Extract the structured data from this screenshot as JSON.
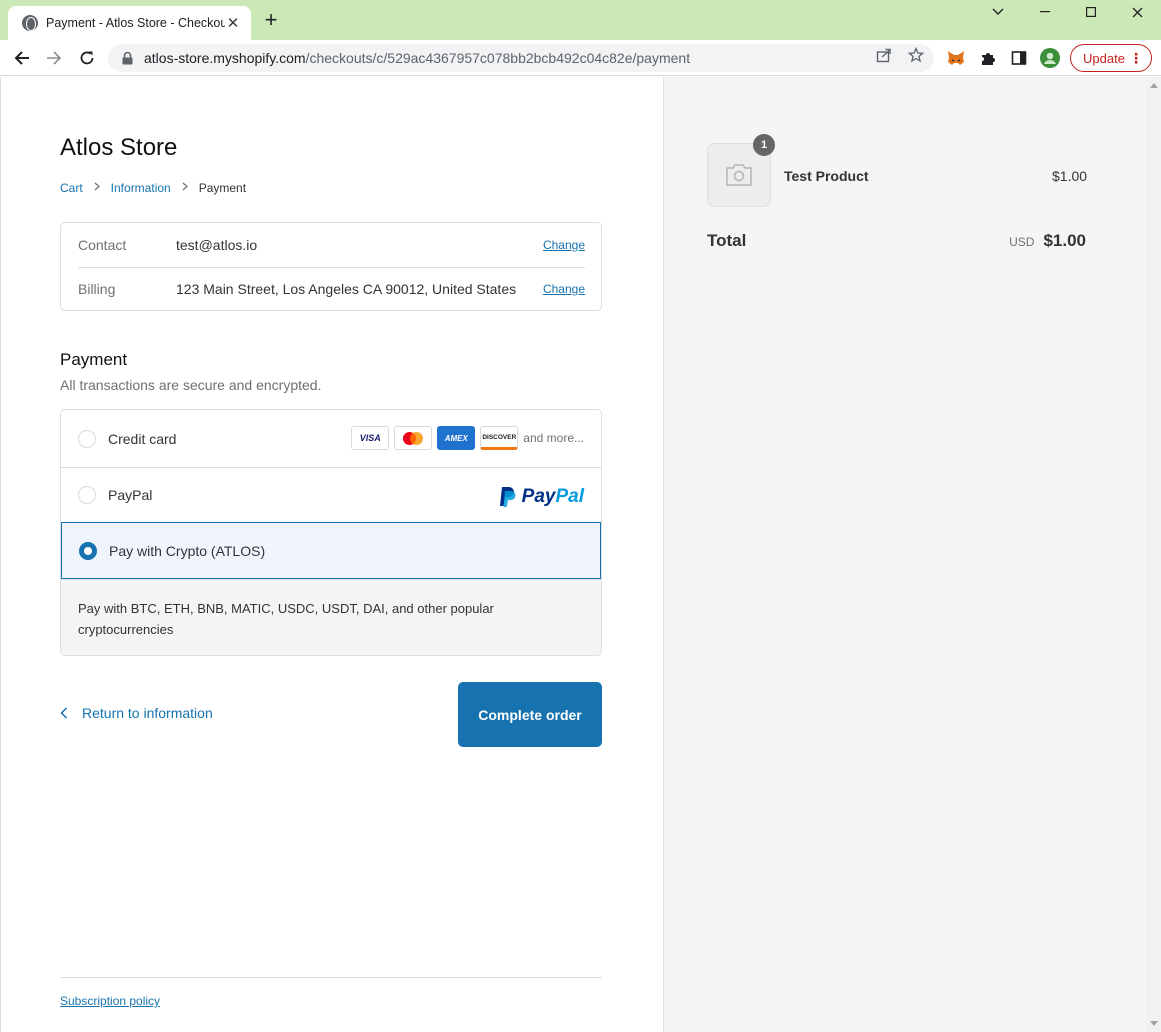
{
  "browser": {
    "tab_title": "Payment - Atlos Store - Checkout",
    "tab_close": "✕",
    "new_tab": "+",
    "url_host": "atlos-store.myshopify.com",
    "url_path": "/checkouts/c/529ac4367957c078bb2bcb492c04c82e/payment",
    "update_label": "Update",
    "menu_dots": "⋮",
    "icons": [
      "globe-icon",
      "back-arrow-icon",
      "forward-arrow-icon",
      "reload-icon",
      "lock-icon",
      "share-icon",
      "star-icon",
      "metamask-fox-icon",
      "puzzle-extension-icon",
      "side-panel-icon",
      "profile-avatar-icon",
      "minimize-icon",
      "maximize-icon",
      "close-window-icon",
      "tab-search-chevron-icon"
    ]
  },
  "checkout": {
    "store_name": "Atlos Store",
    "breadcrumb": {
      "cart": "Cart",
      "information": "Information",
      "payment": "Payment"
    },
    "review": {
      "contact_label": "Contact",
      "contact_value": "test@atlos.io",
      "billing_label": "Billing",
      "billing_value": "123 Main Street, Los Angeles CA 90012, United States",
      "change_label": "Change"
    },
    "payment": {
      "heading": "Payment",
      "subheading": "All transactions are secure and encrypted.",
      "methods": [
        {
          "label": "Credit card",
          "selected": false
        },
        {
          "label": "PayPal",
          "selected": false
        },
        {
          "label": "Pay with Crypto (ATLOS)",
          "selected": true
        }
      ],
      "card_brands": {
        "visa": "VISA",
        "amex": "AMEX",
        "discover": "DISCOVER"
      },
      "and_more": "and more...",
      "paypal_logo": {
        "pay": "Pay",
        "pal": "Pal"
      },
      "crypto_description": "Pay with BTC, ETH, BNB, MATIC, USDC, USDT, DAI, and other popular cryptocurrencies"
    },
    "return_link": "Return to information",
    "complete_button": "Complete order",
    "subscription_policy": "Subscription policy"
  },
  "summary": {
    "product_name": "Test Product",
    "quantity": "1",
    "price": "$1.00",
    "total_label": "Total",
    "currency": "USD",
    "total_amount": "$1.00"
  },
  "colors": {
    "accent": "#1773b0",
    "tabbar": "#cde8b7",
    "sidebar_bg": "#f5f5f5",
    "update_red": "#c5221f"
  }
}
